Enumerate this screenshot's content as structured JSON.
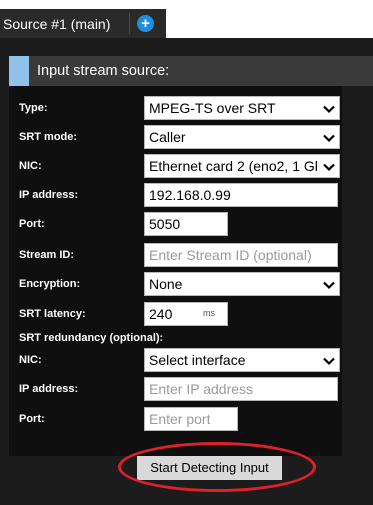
{
  "tabs": {
    "active_label": "Source #1 (main)",
    "add_symbol": "+"
  },
  "section": {
    "title": "Input stream source:"
  },
  "form": {
    "type": {
      "label": "Type:",
      "value": "MPEG-TS over SRT"
    },
    "srt_mode": {
      "label": "SRT mode:",
      "value": "Caller"
    },
    "nic": {
      "label": "NIC:",
      "value": "Ethernet card 2 (eno2, 1 Gb"
    },
    "ip_address": {
      "label": "IP address:",
      "value": "192.168.0.99"
    },
    "port": {
      "label": "Port:",
      "value": "5050"
    },
    "stream_id": {
      "label": "Stream ID:",
      "value": "",
      "placeholder": "Enter Stream ID (optional)"
    },
    "encryption": {
      "label": "Encryption:",
      "value": "None"
    },
    "srt_latency": {
      "label": "SRT latency:",
      "value": "240",
      "unit": "ms"
    },
    "redundancy": {
      "heading": "SRT redundancy (optional):",
      "nic": {
        "label": "NIC:",
        "value": "Select interface"
      },
      "ip_address": {
        "label": "IP address:",
        "value": "",
        "placeholder": "Enter IP address"
      },
      "port": {
        "label": "Port:",
        "value": "",
        "placeholder": "Enter port"
      }
    }
  },
  "actions": {
    "start_detecting_label": "Start Detecting Input"
  },
  "colors": {
    "accent_blue": "#1e8fde",
    "section_accent": "#8fc1ea",
    "annotation_red": "#e0202a",
    "panel_bg": "#1c1c1c",
    "form_bg": "#0f0f0f"
  }
}
